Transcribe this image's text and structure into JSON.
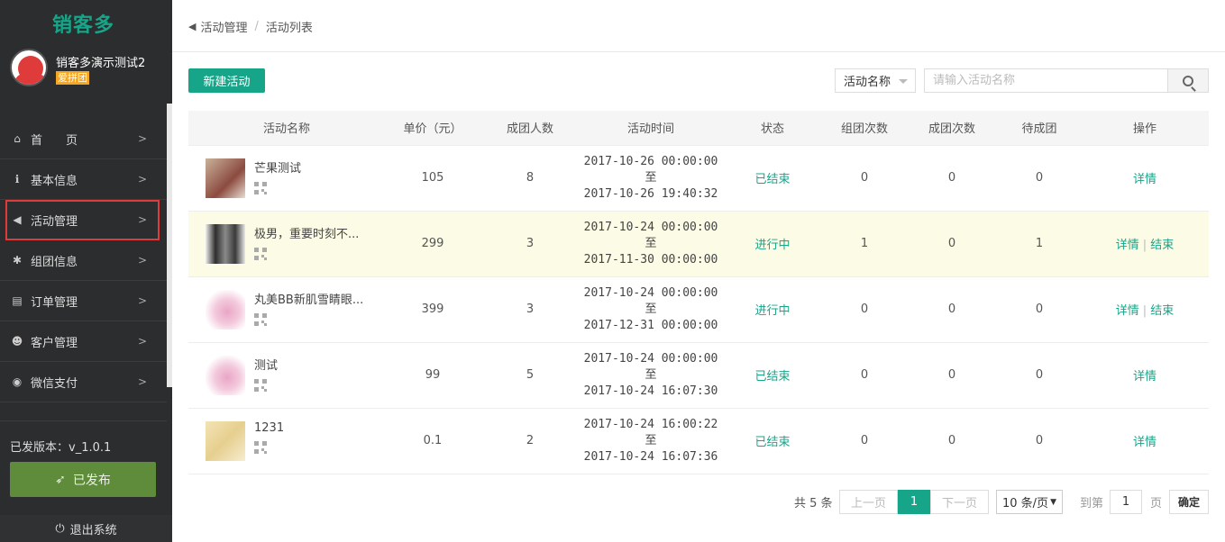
{
  "app": {
    "logo": "销客多"
  },
  "user": {
    "name": "销客多演示测试2",
    "tag": "爱拼团"
  },
  "sidebar": {
    "items": [
      {
        "label": "首　　页",
        "icon": "home-icon",
        "glyph": "⌂",
        "active": false
      },
      {
        "label": "基本信息",
        "icon": "info-icon",
        "glyph": "ℹ",
        "active": false
      },
      {
        "label": "活动管理",
        "icon": "megaphone-icon",
        "glyph": "◀",
        "active": true
      },
      {
        "label": "组团信息",
        "icon": "cluster-icon",
        "glyph": "✱",
        "active": false
      },
      {
        "label": "订单管理",
        "icon": "basket-icon",
        "glyph": "▤",
        "active": false
      },
      {
        "label": "客户管理",
        "icon": "user-icon",
        "glyph": "☻",
        "active": false
      },
      {
        "label": "微信支付",
        "icon": "wechat-pay-icon",
        "glyph": "◉",
        "active": false
      }
    ],
    "version": "已发版本：v_1.0.1",
    "publish_label": "已发布",
    "logout_label": "退出系统"
  },
  "breadcrumb": {
    "parent": "活动管理",
    "current": "活动列表"
  },
  "toolbar": {
    "new_label": "新建活动",
    "filter_selected": "活动名称",
    "search_placeholder": "请输入活动名称"
  },
  "table": {
    "headers": [
      "活动名称",
      "单价（元）",
      "成团人数",
      "活动时间",
      "状态",
      "组团次数",
      "成团次数",
      "待成团",
      "操作"
    ],
    "rows": [
      {
        "name": "芒果测试",
        "price": "105",
        "size": "8",
        "start": "2017-10-26 00:00:00",
        "to": "至",
        "end": "2017-10-26 19:40:32",
        "status": "已结束",
        "groups": "0",
        "success": "0",
        "pending": "0",
        "ops": [
          "详情"
        ]
      },
      {
        "name": "极男，重要时刻不...",
        "price": "299",
        "size": "3",
        "start": "2017-10-24 00:00:00",
        "to": "至",
        "end": "2017-11-30 00:00:00",
        "status": "进行中",
        "groups": "1",
        "success": "0",
        "pending": "1",
        "ops": [
          "详情",
          "结束"
        ]
      },
      {
        "name": "丸美BB新肌雪睛眼...",
        "price": "399",
        "size": "3",
        "start": "2017-10-24 00:00:00",
        "to": "至",
        "end": "2017-12-31 00:00:00",
        "status": "进行中",
        "groups": "0",
        "success": "0",
        "pending": "0",
        "ops": [
          "详情",
          "结束"
        ]
      },
      {
        "name": "测试",
        "price": "99",
        "size": "5",
        "start": "2017-10-24 00:00:00",
        "to": "至",
        "end": "2017-10-24 16:07:30",
        "status": "已结束",
        "groups": "0",
        "success": "0",
        "pending": "0",
        "ops": [
          "详情"
        ]
      },
      {
        "name": "1231",
        "price": "0.1",
        "size": "2",
        "start": "2017-10-24 16:00:22",
        "to": "至",
        "end": "2017-10-24 16:07:36",
        "status": "已结束",
        "groups": "0",
        "success": "0",
        "pending": "0",
        "ops": [
          "详情"
        ]
      }
    ],
    "ops_separator": "|"
  },
  "pagination": {
    "total": "共 5 条",
    "prev": "上一页",
    "current": "1",
    "next": "下一页",
    "page_size": "10 条/页",
    "goto": "到第",
    "goto_value": "1",
    "page_unit": "页",
    "confirm": "确定"
  },
  "colors": {
    "accent": "#17a589",
    "sidebar_bg": "#2b2d2e",
    "publish": "#5e8c3a",
    "highlight_row": "#fcfbe5",
    "active_outline": "#e03b3b"
  }
}
